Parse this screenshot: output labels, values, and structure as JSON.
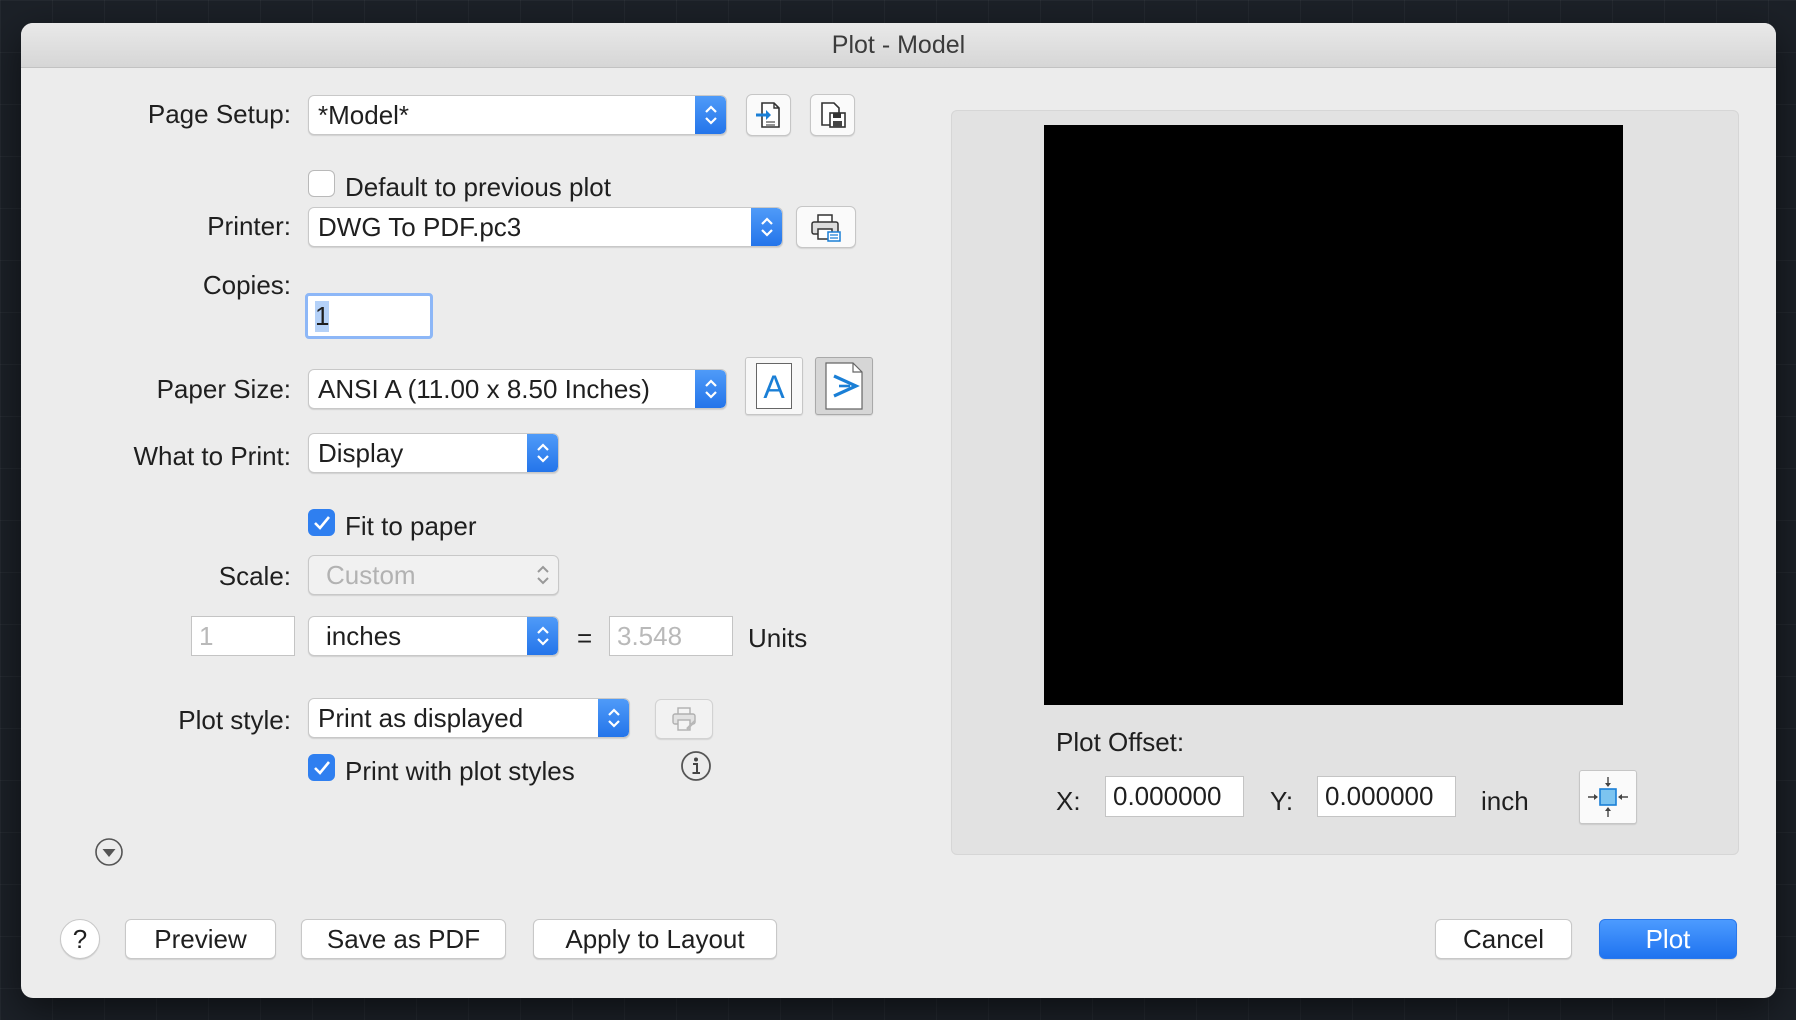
{
  "window": {
    "title": "Plot - Model"
  },
  "page_setup": {
    "label": "Page Setup:",
    "value": "*Model*",
    "default_checkbox_label": "Default to previous plot",
    "default_checked": false
  },
  "printer": {
    "label": "Printer:",
    "value": "DWG To PDF.pc3"
  },
  "copies": {
    "label": "Copies:",
    "value": "1"
  },
  "paper_size": {
    "label": "Paper Size:",
    "value": "ANSI A (11.00 x 8.50 Inches)",
    "portrait_glyph": "A"
  },
  "what_to_print": {
    "label": "What to Print:",
    "value": "Display"
  },
  "fit_to_paper": {
    "label": "Fit to paper",
    "checked": true
  },
  "scale": {
    "label": "Scale:",
    "value": "Custom",
    "left_value": "1",
    "units_value": "inches",
    "equals": "=",
    "right_value": "3.548",
    "units_label": "Units"
  },
  "plot_style": {
    "label": "Plot style:",
    "value": "Print as displayed",
    "print_with_styles_label": "Print with plot styles",
    "print_with_styles_checked": true
  },
  "plot_offset": {
    "label": "Plot Offset:",
    "x_label": "X:",
    "x_value": "0.000000",
    "y_label": "Y:",
    "y_value": "0.000000",
    "unit": "inch"
  },
  "buttons": {
    "help": "?",
    "preview": "Preview",
    "save_pdf": "Save as PDF",
    "apply_layout": "Apply to Layout",
    "cancel": "Cancel",
    "plot": "Plot"
  },
  "colors": {
    "accent": "#2f7ff0",
    "primary_button": "#1f73f0",
    "preview": "#000000"
  },
  "icons": [
    "import-page-setup-icon",
    "save-page-setup-icon",
    "printer-properties-icon",
    "portrait-icon",
    "landscape-icon",
    "plot-style-edit-icon",
    "info-icon",
    "expand-icon",
    "center-plot-icon",
    "stepper-icon",
    "checkmark-icon"
  ]
}
